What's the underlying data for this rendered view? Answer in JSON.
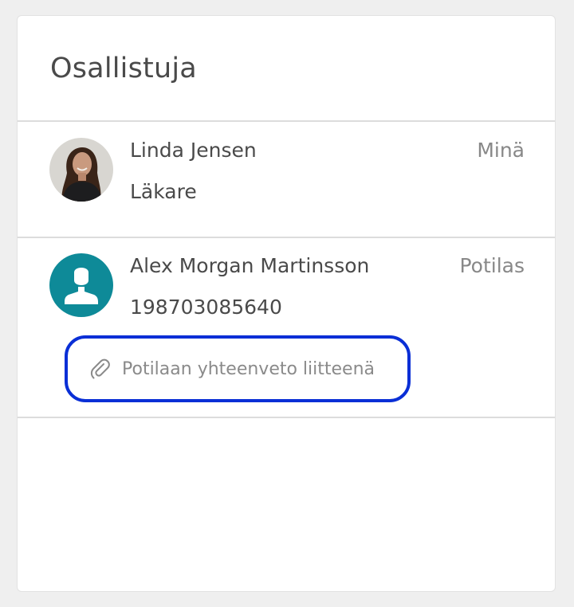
{
  "panel": {
    "title": "Osallistuja"
  },
  "participants": [
    {
      "name": "Linda Jensen",
      "subtitle": "Läkare",
      "role": "Minä",
      "avatar": "photo"
    },
    {
      "name": "Alex Morgan Martinsson",
      "subtitle": "198703085640",
      "role": "Potilas",
      "avatar": "person-placeholder-icon",
      "avatar_color": "#0e8a98",
      "attachment": {
        "label": "Potilaan yhteenveto liitteenä",
        "icon": "paperclip-icon",
        "highlight_color": "#0a2fd6"
      }
    }
  ]
}
